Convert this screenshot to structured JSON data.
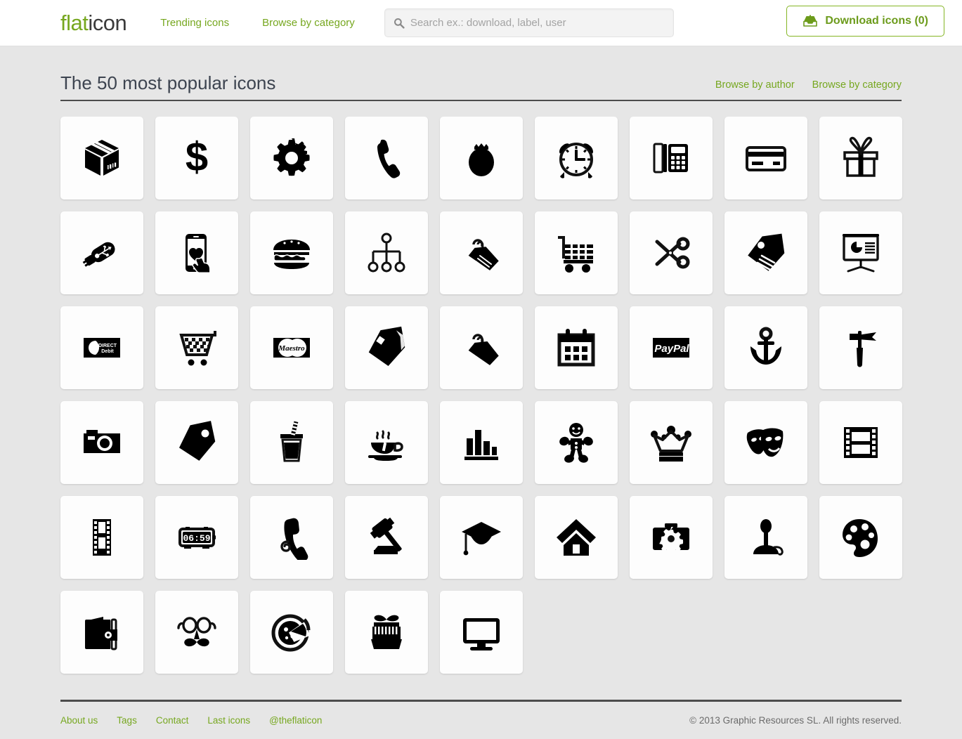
{
  "colors": {
    "brand_green": "#76a71f",
    "dark_text": "#3d4450",
    "page_bg": "#e6e6e6",
    "tile_bg": "#fdfdfd",
    "rule": "#4c4c4c"
  },
  "header": {
    "logo_part1": "flat",
    "logo_part2": "icon",
    "nav": [
      {
        "label": "Trending icons",
        "name": "nav-trending-icons"
      },
      {
        "label": "Browse by category",
        "name": "nav-browse-by-category"
      }
    ],
    "search": {
      "placeholder": "Search ex.: download, label, user",
      "value": "",
      "icon": "search-icon"
    },
    "download_button": {
      "label": "Download icons (0)",
      "count": 0,
      "icon": "download-inbox-icon"
    }
  },
  "main": {
    "title": "The 50 most popular icons",
    "links": [
      {
        "label": "Browse by author",
        "name": "link-browse-by-author"
      },
      {
        "label": "Browse by category",
        "name": "link-browse-by-category"
      }
    ],
    "grid": {
      "columns": 9,
      "count": 50,
      "icons": [
        {
          "name": "package-box-icon",
          "label": "Package box"
        },
        {
          "name": "dollar-sign-icon",
          "label": "Dollar sign"
        },
        {
          "name": "gear-icon",
          "label": "Gear"
        },
        {
          "name": "phone-handset-icon",
          "label": "Phone handset"
        },
        {
          "name": "money-bag-icon",
          "label": "Money bag"
        },
        {
          "name": "alarm-clock-icon",
          "label": "Alarm clock"
        },
        {
          "name": "desk-phone-icon",
          "label": "Desk phone"
        },
        {
          "name": "credit-card-icon",
          "label": "Credit card"
        },
        {
          "name": "gift-box-icon",
          "label": "Gift box"
        },
        {
          "name": "usb-drive-icon",
          "label": "USB drive"
        },
        {
          "name": "smartphone-heart-touch-icon",
          "label": "Smartphone heart touch"
        },
        {
          "name": "hamburger-icon",
          "label": "Hamburger"
        },
        {
          "name": "sitemap-icon",
          "label": "Sitemap"
        },
        {
          "name": "price-tags-hook-icon",
          "label": "Price tags with hook"
        },
        {
          "name": "shopping-cart-icon",
          "label": "Shopping cart"
        },
        {
          "name": "scissors-icon",
          "label": "Scissors"
        },
        {
          "name": "price-tag-lines-icon",
          "label": "Price tag with lines"
        },
        {
          "name": "presentation-chart-icon",
          "label": "Presentation chart board"
        },
        {
          "name": "direct-debit-card-icon",
          "label": "Direct Debit card",
          "text": "DIRECT Debit"
        },
        {
          "name": "checkered-cart-icon",
          "label": "Checkered shopping cart"
        },
        {
          "name": "maestro-card-icon",
          "label": "Maestro card",
          "text": "Maestro"
        },
        {
          "name": "price-tag-icon",
          "label": "Price tag"
        },
        {
          "name": "tag-hook-icon",
          "label": "Tag with hook"
        },
        {
          "name": "calendar-icon",
          "label": "Calendar"
        },
        {
          "name": "paypal-card-icon",
          "label": "PayPal card",
          "text": "PayPal"
        },
        {
          "name": "anchor-icon",
          "label": "Anchor"
        },
        {
          "name": "hammer-tool-icon",
          "label": "Hammer tool"
        },
        {
          "name": "photo-camera-icon",
          "label": "Photo camera"
        },
        {
          "name": "tag-dot-icon",
          "label": "Tag with dot"
        },
        {
          "name": "soda-cup-icon",
          "label": "Soda cup with straw"
        },
        {
          "name": "coffee-cup-icon",
          "label": "Coffee cup"
        },
        {
          "name": "bar-chart-icon",
          "label": "Bar chart"
        },
        {
          "name": "gingerbread-man-icon",
          "label": "Gingerbread man"
        },
        {
          "name": "crown-icon",
          "label": "Crown"
        },
        {
          "name": "theater-masks-icon",
          "label": "Theater masks"
        },
        {
          "name": "film-frame-icon",
          "label": "Film frame"
        },
        {
          "name": "film-strip-icon",
          "label": "Film strip"
        },
        {
          "name": "digital-clock-icon",
          "label": "Digital clock",
          "text": "06:59"
        },
        {
          "name": "telephone-cord-icon",
          "label": "Telephone with cord"
        },
        {
          "name": "gavel-icon",
          "label": "Gavel"
        },
        {
          "name": "graduation-cap-icon",
          "label": "Graduation cap"
        },
        {
          "name": "home-icon",
          "label": "Home"
        },
        {
          "name": "camera-gear-icon",
          "label": "Camera with gear"
        },
        {
          "name": "joystick-icon",
          "label": "Joystick"
        },
        {
          "name": "paint-palette-icon",
          "label": "Paint palette"
        },
        {
          "name": "wallet-icon",
          "label": "Wallet"
        },
        {
          "name": "glasses-moustache-icon",
          "label": "Glasses and moustache"
        },
        {
          "name": "pizza-icon",
          "label": "Pizza"
        },
        {
          "name": "market-stall-icon",
          "label": "Market stall"
        },
        {
          "name": "monitor-icon",
          "label": "Monitor"
        }
      ]
    }
  },
  "footer": {
    "links": [
      {
        "label": "About us",
        "name": "footer-link-about-us"
      },
      {
        "label": "Tags",
        "name": "footer-link-tags"
      },
      {
        "label": "Contact",
        "name": "footer-link-contact"
      },
      {
        "label": "Last icons",
        "name": "footer-link-last-icons"
      },
      {
        "label": "@theflaticon",
        "name": "footer-link-twitter"
      }
    ],
    "copyright": "© 2013 Graphic Resources SL. All rights reserved."
  }
}
